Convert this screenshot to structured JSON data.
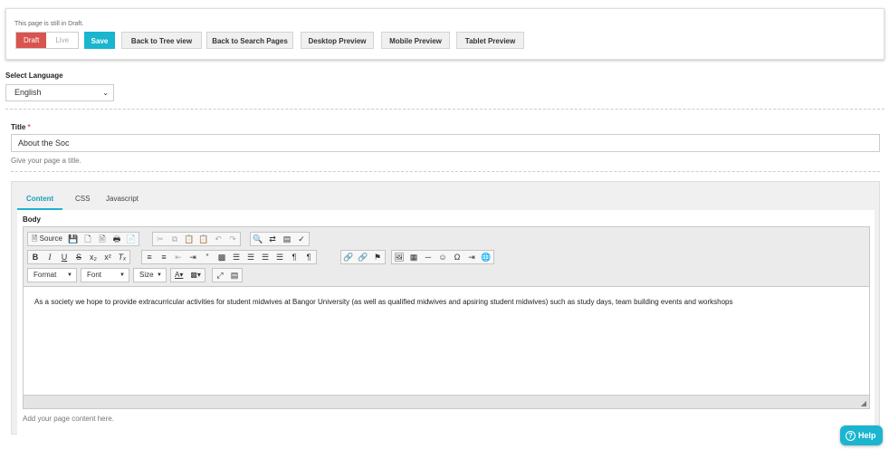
{
  "status_bar": {
    "draft_note": "This page is still in Draft.",
    "draft_label": "Draft",
    "live_label": "Live",
    "save_label": "Save",
    "buttons": [
      "Back to Tree view",
      "Back to Search Pages",
      "Desktop Preview",
      "Mobile Preview",
      "Tablet Preview"
    ]
  },
  "language": {
    "label": "Select Language",
    "selected": "English"
  },
  "title_field": {
    "label": "Title",
    "required_mark": "*",
    "value": "About the Soc",
    "help": "Give your page a title."
  },
  "tabs": [
    "Content",
    "CSS",
    "Javascript"
  ],
  "editor": {
    "body_label": "Body",
    "source_label": "Source",
    "format_label": "Format",
    "font_label": "Font",
    "size_label": "Size",
    "content": "As a society we hope to provide extracurricular activities for student midwives at Bangor University (as well as qualified midwives and apsiring student midwives) such as study days, team building events and workshops",
    "help": "Add your page content here."
  },
  "help_button": "Help",
  "colors": {
    "accent": "#1ab5cf",
    "draft": "#d9534f"
  }
}
